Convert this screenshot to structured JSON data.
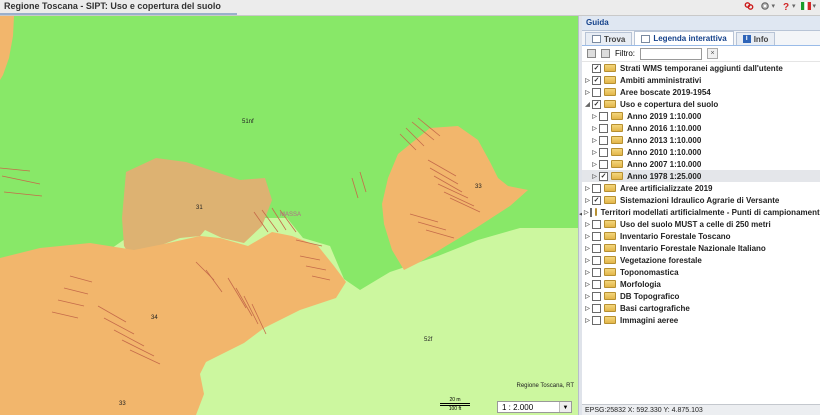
{
  "app": {
    "title": "Regione Toscana - SIPT: Uso e copertura del suolo"
  },
  "toolbar_icons": [
    "broken-link-icon",
    "gear-icon",
    "help-icon",
    "italy-flag-icon"
  ],
  "map": {
    "labels": [
      "51nf",
      "31",
      "33",
      "34",
      "52f",
      "33"
    ],
    "place": "MASSA",
    "credit": "Regione Toscana, RT",
    "scalebar": {
      "top": "20 m",
      "bottom": "100 ft"
    },
    "scale_value": "1 : 2.000",
    "colors": {
      "grassland": "#88e868",
      "agricultural": "#ddb272",
      "orange": "#f2b66c",
      "meadow": "#ccf79f",
      "hatch": "#c56b4a"
    }
  },
  "panel": {
    "title": "Guida",
    "tabs": [
      {
        "label": "Trova"
      },
      {
        "label": "Legenda interattiva"
      },
      {
        "label": "Info"
      }
    ],
    "filter_label": "Filtro:",
    "filter_value": "",
    "tree": [
      {
        "label": "Strati WMS temporanei aggiunti dall'utente",
        "checked": true
      },
      {
        "label": "Ambiti amministrativi",
        "checked": true
      },
      {
        "label": "Aree boscate 2019-1954",
        "checked": false
      },
      {
        "label": "Uso e copertura del suolo",
        "checked": true
      },
      {
        "label": "Anno 2019 1:10.000",
        "checked": false
      },
      {
        "label": "Anno 2016 1:10.000",
        "checked": false
      },
      {
        "label": "Anno 2013 1:10.000",
        "checked": false
      },
      {
        "label": "Anno 2010 1:10.000",
        "checked": false
      },
      {
        "label": "Anno 2007 1:10.000",
        "checked": false
      },
      {
        "label": "Anno 1978 1:25.000",
        "checked": true
      },
      {
        "label": "Aree artificializzate 2019",
        "checked": false
      },
      {
        "label": "Sistemazioni Idraulico Agrarie di Versante",
        "checked": true
      },
      {
        "label": "Territori modellati artificialmente - Punti di campionamento",
        "checked": false
      },
      {
        "label": "Uso del suolo MUST a celle di 250 metri",
        "checked": false
      },
      {
        "label": "Inventario Forestale Toscano",
        "checked": false
      },
      {
        "label": "Inventario Forestale Nazionale Italiano",
        "checked": false
      },
      {
        "label": "Vegetazione forestale",
        "checked": false
      },
      {
        "label": "Toponomastica",
        "checked": false
      },
      {
        "label": "Morfologia",
        "checked": false
      },
      {
        "label": "DB Topografico",
        "checked": false
      },
      {
        "label": "Basi cartografiche",
        "checked": false
      },
      {
        "label": "Immagini aeree",
        "checked": false
      }
    ],
    "status": "EPSG:25832  X: 592.330  Y: 4.875.103"
  }
}
